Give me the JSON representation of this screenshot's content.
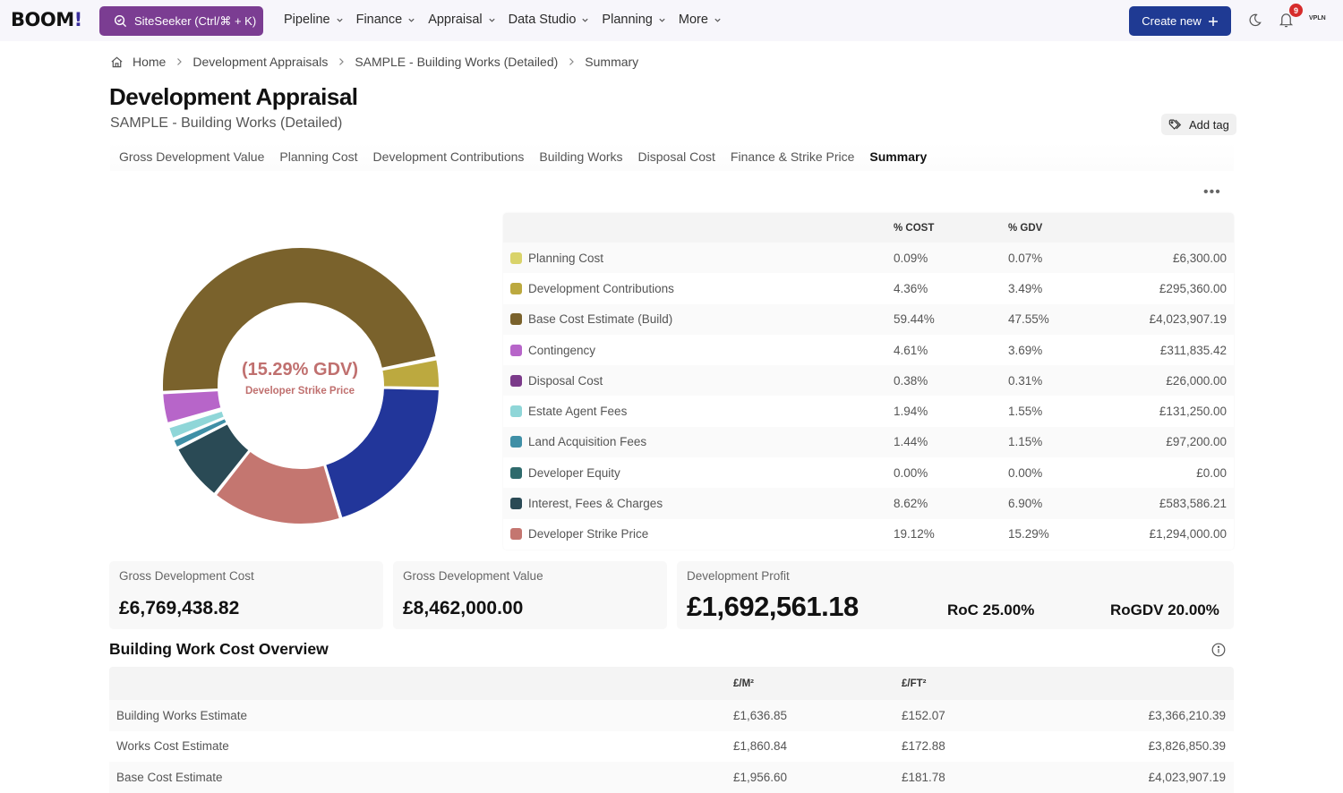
{
  "app": {
    "logo": "BOOM",
    "logo_mark": "!",
    "siteseeker_label": "SiteSeeker (Ctrl/⌘ + K)",
    "nav": [
      {
        "label": "Pipeline"
      },
      {
        "label": "Finance"
      },
      {
        "label": "Appraisal"
      },
      {
        "label": "Data Studio"
      },
      {
        "label": "Planning"
      },
      {
        "label": "More"
      }
    ],
    "create_new_label": "Create new",
    "notification_count": "9",
    "user_label": "VPLN"
  },
  "breadcrumb": [
    "Home",
    "Development Appraisals",
    "SAMPLE - Building Works (Detailed)",
    "Summary"
  ],
  "page": {
    "title": "Development Appraisal",
    "subtitle": "SAMPLE - Building Works (Detailed)",
    "add_tag_label": "Add tag"
  },
  "tabs": [
    {
      "label": "Gross Development Value",
      "active": false
    },
    {
      "label": "Planning Cost",
      "active": false
    },
    {
      "label": "Development Contributions",
      "active": false
    },
    {
      "label": "Building Works",
      "active": false
    },
    {
      "label": "Disposal Cost",
      "active": false
    },
    {
      "label": "Finance & Strike Price",
      "active": false
    },
    {
      "label": "Summary",
      "active": true
    }
  ],
  "donut": {
    "center_value": "(15.29% GDV)",
    "center_label": "Developer Strike Price"
  },
  "breakdown": {
    "headers": {
      "name": "",
      "cost": "% COST",
      "gdv": "% GDV",
      "value": ""
    },
    "rows": [
      {
        "name": "Planning Cost",
        "color": "#d9d36a",
        "cost": "0.09%",
        "gdv": "0.07%",
        "value": "£6,300.00"
      },
      {
        "name": "Development Contributions",
        "color": "#bca93f",
        "cost": "4.36%",
        "gdv": "3.49%",
        "value": "£295,360.00"
      },
      {
        "name": "Base Cost Estimate (Build)",
        "color": "#7a622c",
        "cost": "59.44%",
        "gdv": "47.55%",
        "value": "£4,023,907.19"
      },
      {
        "name": "Contingency",
        "color": "#b765c9",
        "cost": "4.61%",
        "gdv": "3.69%",
        "value": "£311,835.42"
      },
      {
        "name": "Disposal Cost",
        "color": "#7b3a8a",
        "cost": "0.38%",
        "gdv": "0.31%",
        "value": "£26,000.00"
      },
      {
        "name": "Estate Agent Fees",
        "color": "#8fd6d8",
        "cost": "1.94%",
        "gdv": "1.55%",
        "value": "£131,250.00"
      },
      {
        "name": "Land Acquisition Fees",
        "color": "#3f8fa6",
        "cost": "1.44%",
        "gdv": "1.15%",
        "value": "£97,200.00"
      },
      {
        "name": "Developer Equity",
        "color": "#2f6a6c",
        "cost": "0.00%",
        "gdv": "0.00%",
        "value": "£0.00"
      },
      {
        "name": "Interest, Fees & Charges",
        "color": "#2a4a55",
        "cost": "8.62%",
        "gdv": "6.90%",
        "value": "£583,586.21"
      },
      {
        "name": "Developer Strike Price",
        "color": "#c47670",
        "cost": "19.12%",
        "gdv": "15.29%",
        "value": "£1,294,000.00"
      }
    ],
    "unlisted_segment_color": "#22369a"
  },
  "kpis": {
    "gdc": {
      "label": "Gross Development Cost",
      "value": "£6,769,438.82"
    },
    "gdv": {
      "label": "Gross Development Value",
      "value": "£8,462,000.00"
    },
    "profit": {
      "label": "Development Profit",
      "value": "£1,692,561.18",
      "roc": "RoC 25.00%",
      "rogdv": "RoGDV 20.00%"
    }
  },
  "building_works": {
    "title": "Building Work Cost Overview",
    "headers": {
      "name": "",
      "m2": "£/M²",
      "ft2": "£/FT²",
      "total": ""
    },
    "rows": [
      {
        "name": "Building Works Estimate",
        "m2": "£1,636.85",
        "ft2": "£152.07",
        "total": "£3,366,210.39"
      },
      {
        "name": "Works Cost Estimate",
        "m2": "£1,860.84",
        "ft2": "£172.88",
        "total": "£3,826,850.39"
      },
      {
        "name": "Base Cost Estimate",
        "m2": "£1,956.60",
        "ft2": "£181.78",
        "total": "£4,023,907.19"
      }
    ]
  },
  "chart_data": {
    "type": "pie",
    "title": "",
    "center_text": "(15.29% GDV) Developer Strike Price",
    "categories": [
      "Planning Cost",
      "Development Contributions",
      "Base Cost Estimate (Build)",
      "Contingency",
      "Disposal Cost",
      "Estate Agent Fees",
      "Land Acquisition Fees",
      "Developer Equity",
      "Interest, Fees & Charges",
      "Developer Strike Price"
    ],
    "values": [
      6300.0,
      295360.0,
      4023907.19,
      311835.42,
      26000.0,
      131250.0,
      97200.0,
      0.0,
      583586.21,
      1294000.0
    ],
    "units": "GBP",
    "legend": "right (table)"
  }
}
